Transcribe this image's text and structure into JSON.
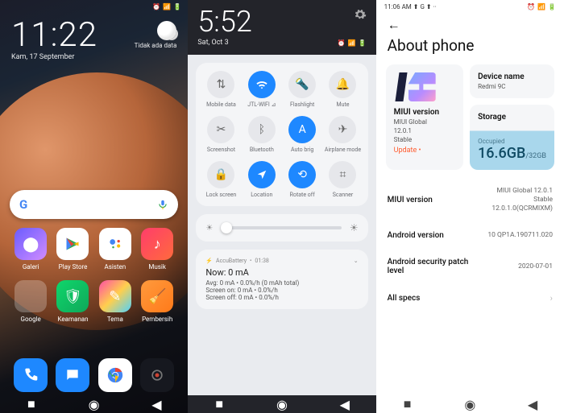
{
  "screen1": {
    "time": "11:22",
    "date": "Kam, 17 September",
    "weather_text": "Tidak ada data",
    "search_placeholder": "",
    "apps_row1": [
      {
        "label": "Galeri",
        "bg": "linear-gradient(135deg,#6a5cff,#d18cff)"
      },
      {
        "label": "Play Store",
        "bg": "#fff"
      },
      {
        "label": "Asisten",
        "bg": "#fff"
      },
      {
        "label": "Musik",
        "bg": "linear-gradient(135deg,#ff3d6b,#ff6a3d)"
      }
    ],
    "apps_row2": [
      {
        "label": "Google",
        "bg": "folder"
      },
      {
        "label": "Keamanan",
        "bg": "linear-gradient(135deg,#0fd66b,#0fa85a)"
      },
      {
        "label": "Tema",
        "bg": "linear-gradient(135deg,#ff4da6,#ffcf4d 50%,#4dd2ff)"
      },
      {
        "label": "Pembersih",
        "bg": "linear-gradient(135deg,#ff9a3d,#ff7a1a)"
      }
    ],
    "dock": [
      {
        "name": "phone",
        "bg": "#1e88ff"
      },
      {
        "name": "messages",
        "bg": "#1e88ff"
      },
      {
        "name": "chrome",
        "bg": "#fff"
      },
      {
        "name": "camera",
        "bg": "#16181f"
      }
    ]
  },
  "screen2": {
    "time": "5:52",
    "date": "Sat, Oct 3",
    "toggles": [
      {
        "label": "Mobile data",
        "icon": "⇅",
        "on": false
      },
      {
        "label": "JTL-WIFI ⊿",
        "icon": "wifi",
        "on": true
      },
      {
        "label": "Flashlight",
        "icon": "flash",
        "on": false
      },
      {
        "label": "Mute",
        "icon": "bell",
        "on": false
      },
      {
        "label": "Screenshot",
        "icon": "scissors",
        "on": false
      },
      {
        "label": "Bluetooth",
        "icon": "bt",
        "on": false
      },
      {
        "label": "Auto brig",
        "icon": "A",
        "on": true
      },
      {
        "label": "Airplane mode",
        "icon": "plane",
        "on": false
      },
      {
        "label": "Lock screen",
        "icon": "lock",
        "on": false
      },
      {
        "label": "Location",
        "icon": "nav",
        "on": true
      },
      {
        "label": "Rotate off",
        "icon": "rotate",
        "on": true
      },
      {
        "label": "Scanner",
        "icon": "scan",
        "on": false
      }
    ],
    "notif": {
      "app": "AccuBattery",
      "when": "01:38",
      "title": "Now: 0 mA",
      "line1": "Avg: 0 mA • 0.0%/h (0 mAh total)",
      "line2": "Screen on: 0 mA • 0.0%/h",
      "line3": "Screen off: 0 mA • 0.0%/h"
    }
  },
  "screen3": {
    "status_time": "11:06 AM",
    "status_icons": "⬆ G ⬆ ··",
    "title": "About phone",
    "miui_card": {
      "h": "MIUI version",
      "l1": "MIUI Global",
      "l2": "12.0.1",
      "l3": "Stable",
      "update": "Update •"
    },
    "device_card": {
      "h": "Device name",
      "v": "Redmi 9C"
    },
    "storage_card": {
      "h": "Storage",
      "occ": "Occupied",
      "used": "16.6GB",
      "total": "/32GB"
    },
    "rows": [
      {
        "k": "MIUI version",
        "v": "MIUI Global 12.0.1\nStable\n12.0.1.0(QCRMIXM)"
      },
      {
        "k": "Android version",
        "v": "10 QP1A.190711.020"
      },
      {
        "k": "Android security patch level",
        "v": "2020-07-01"
      },
      {
        "k": "All specs",
        "v": ""
      }
    ]
  }
}
